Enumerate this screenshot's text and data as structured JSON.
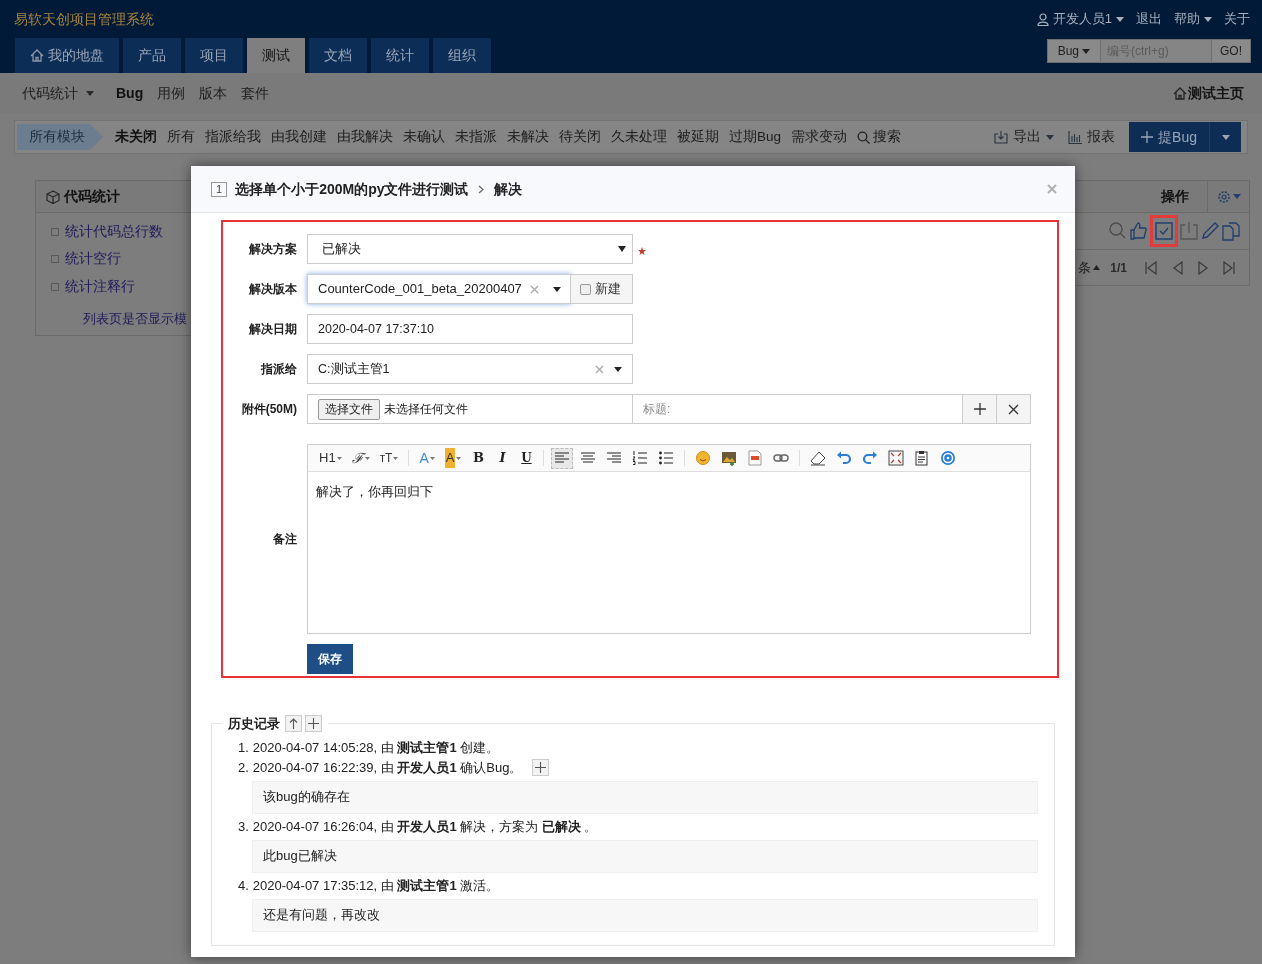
{
  "app_title": "易软天创项目管理系统",
  "user_menu": [
    {
      "kind": "user",
      "label": "开发人员1"
    },
    {
      "kind": "link",
      "label": "退出"
    },
    {
      "kind": "dropdown",
      "label": "帮助"
    },
    {
      "kind": "link",
      "label": "关于"
    }
  ],
  "main_nav": [
    {
      "label": "我的地盘",
      "kind": "home",
      "selected": false
    },
    {
      "label": "产品",
      "kind": "plain",
      "selected": false
    },
    {
      "label": "项目",
      "kind": "plain",
      "selected": false
    },
    {
      "label": "测试",
      "kind": "plain",
      "selected": true
    },
    {
      "label": "文档",
      "kind": "plain",
      "selected": false
    },
    {
      "label": "统计",
      "kind": "plain",
      "selected": false
    },
    {
      "label": "组织",
      "kind": "plain",
      "selected": false
    }
  ],
  "quick_jump": {
    "type": "Bug",
    "placeholder": "编号(ctrl+g)",
    "button": "GO!"
  },
  "sub_nav": [
    {
      "label": "代码统计",
      "kind": "dropdown",
      "selected": false
    },
    {
      "label": "Bug",
      "kind": "link",
      "selected": true
    },
    {
      "label": "用例",
      "kind": "link",
      "selected": false
    },
    {
      "label": "版本",
      "kind": "link",
      "selected": false
    },
    {
      "label": "套件",
      "kind": "link",
      "selected": false
    }
  ],
  "home_link": "测试主页",
  "filter_bar": {
    "module": "所有模块",
    "filters": [
      {
        "label": "未关闭",
        "selected": true
      },
      {
        "label": "所有",
        "selected": false
      },
      {
        "label": "指派给我",
        "selected": false
      },
      {
        "label": "由我创建",
        "selected": false
      },
      {
        "label": "由我解决",
        "selected": false
      },
      {
        "label": "未确认",
        "selected": false
      },
      {
        "label": "未指派",
        "selected": false
      },
      {
        "label": "未解决",
        "selected": false
      },
      {
        "label": "待关闭",
        "selected": false
      },
      {
        "label": "久未处理",
        "selected": false
      },
      {
        "label": "被延期",
        "selected": false
      },
      {
        "label": "过期Bug",
        "selected": false
      },
      {
        "label": "需求变动",
        "selected": false
      }
    ],
    "search": "搜索",
    "export": "导出",
    "report": "报表",
    "create": "提Bug"
  },
  "side_panel": {
    "title": "代码统计",
    "items": [
      {
        "label": "统计代码总行数",
        "checked": false
      },
      {
        "label": "统计空行",
        "checked": false
      },
      {
        "label": "统计注释行",
        "checked": false
      }
    ],
    "link": "列表页是否显示模"
  },
  "bug_table": {
    "action_header": "操作",
    "actions": [
      {
        "kind": "search",
        "highlighted": false
      },
      {
        "kind": "confirm",
        "highlighted": false
      },
      {
        "kind": "resolve",
        "highlighted": true
      },
      {
        "kind": "close",
        "highlighted": false
      },
      {
        "kind": "edit",
        "highlighted": false
      },
      {
        "kind": "copy",
        "highlighted": false
      }
    ],
    "pager": {
      "sort": "条",
      "page": "1/1"
    }
  },
  "dialog": {
    "id": "1",
    "title": "选择单个小于200M的py文件进行测试",
    "action": "解决",
    "form": {
      "highlighted": true,
      "resolution": {
        "label": "解决方案",
        "value": "已解决",
        "required": true
      },
      "build": {
        "label": "解决版本",
        "value": "CounterCode_001_beta_20200407",
        "new_label": "新建",
        "new_checked": false
      },
      "date": {
        "label": "解决日期",
        "value": "2020-04-07 17:37:10"
      },
      "assigned_to": {
        "label": "指派给",
        "value": "C:测试主管1"
      },
      "files": {
        "label": "附件(50M)",
        "button": "选择文件",
        "status": "未选择任何文件",
        "title_placeholder": "标题:"
      },
      "comment": {
        "label": "备注",
        "value": "解决了，你再回归下",
        "toolbar": [
          {
            "kind": "heading",
            "label": "H1",
            "selected": false
          },
          {
            "kind": "font-family",
            "label": "ℱ",
            "selected": false
          },
          {
            "kind": "font-size",
            "label": "ᴛT",
            "selected": false
          },
          {
            "kind": "font-color",
            "label": "A",
            "selected": false
          },
          {
            "kind": "back-color",
            "label": "A",
            "selected": false
          },
          {
            "kind": "bold",
            "label": "B",
            "selected": false
          },
          {
            "kind": "italic",
            "label": "I",
            "selected": false
          },
          {
            "kind": "underline",
            "label": "U",
            "selected": false
          },
          {
            "kind": "align-left",
            "selected": true
          },
          {
            "kind": "align-center",
            "selected": false
          },
          {
            "kind": "align-right",
            "selected": false
          },
          {
            "kind": "ordered-list",
            "selected": false
          },
          {
            "kind": "bullet-list",
            "selected": false
          },
          {
            "kind": "emoticon",
            "selected": false
          },
          {
            "kind": "image",
            "selected": false
          },
          {
            "kind": "code",
            "selected": false
          },
          {
            "kind": "link",
            "selected": false
          },
          {
            "kind": "eraser",
            "selected": false
          },
          {
            "kind": "undo",
            "selected": false
          },
          {
            "kind": "redo",
            "selected": false
          },
          {
            "kind": "fullscreen",
            "selected": false
          },
          {
            "kind": "paste",
            "selected": false
          },
          {
            "kind": "help",
            "selected": false
          }
        ]
      },
      "save": "保存"
    },
    "history": {
      "title": "历史记录",
      "entries": [
        {
          "number": "1.",
          "text": "2020-04-07 14:05:28, 由 **测试主管1** 创建。",
          "expandable": false
        },
        {
          "number": "2.",
          "text": "2020-04-07 16:22:39, 由 **开发人员1** 确认Bug。",
          "expandable": true,
          "comment": "该bug的确存在"
        },
        {
          "number": "3.",
          "text": "2020-04-07 16:26:04, 由 **开发人员1** 解决，方案为 **已解决** 。",
          "expandable": false,
          "comment": "此bug已解决"
        },
        {
          "number": "4.",
          "text": "2020-04-07 17:35:12, 由 **测试主管1** 激活。",
          "expandable": false,
          "comment": "还是有问题，再改改"
        }
      ]
    }
  }
}
